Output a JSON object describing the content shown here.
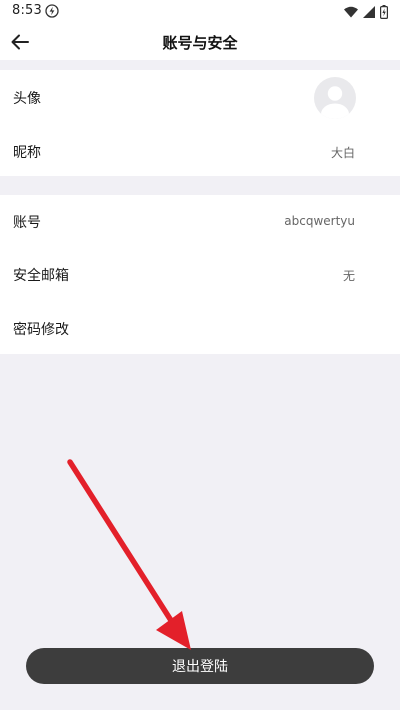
{
  "status_bar": {
    "time": "8:53"
  },
  "header": {
    "title": "账号与安全"
  },
  "profile": {
    "avatar_label": "头像",
    "nickname_label": "昵称",
    "nickname_value": "大白"
  },
  "security": {
    "account_label": "账号",
    "account_value": "abcqwertyu",
    "email_label": "安全邮箱",
    "email_value": "无",
    "password_label": "密码修改"
  },
  "logout": {
    "label": "退出登陆"
  },
  "colors": {
    "background": "#f1f0f5",
    "card": "#ffffff",
    "logout_button": "#3d3d3d",
    "arrow": "#e3202a"
  },
  "icons": {
    "back": "arrow-left-icon",
    "bolt": "bolt-icon",
    "wifi": "wifi-icon",
    "signal": "signal-icon",
    "battery": "battery-icon",
    "avatar": "default-avatar-icon"
  }
}
